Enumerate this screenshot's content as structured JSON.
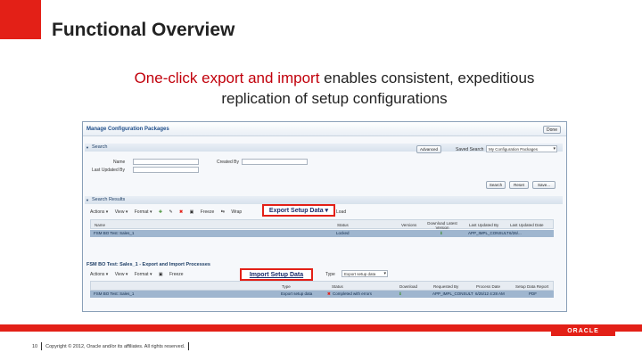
{
  "slide": {
    "title": "Functional Overview",
    "subtitle_highlight": "One-click export and import",
    "subtitle_rest_line1": " enables consistent, expeditious",
    "subtitle_line2": "replication of setup configurations"
  },
  "screenshot": {
    "window_title": "Manage Configuration Packages",
    "done_label": "Done",
    "search": {
      "section_label": "Search",
      "name_label": "Name",
      "created_by_label": "Created By",
      "last_updated_by_label": "Last Updated By",
      "advanced_label": "Advanced",
      "saved_search_label": "Saved Search",
      "saved_search_value": "My Configuration Packages",
      "search_button": "Search",
      "reset_button": "Reset",
      "save_button": "Save..."
    },
    "results": {
      "section_label": "Search Results",
      "toolbar": [
        "Actions ▾",
        "View ▾",
        "Format ▾"
      ],
      "freeze_label": "Freeze",
      "wrap_label": "Wrap",
      "callout_text": "Export Setup Data",
      "callout_suffix": "Load",
      "headers": [
        "Name",
        "Status",
        "Versions",
        "Last Updated By",
        "Last Updated Date"
      ],
      "header_extra": "Download Latest Version",
      "row": [
        "FSM BO Test: Sales_1",
        "Locked",
        "",
        "APP_IMPL_CONSULT",
        "6/26/..."
      ]
    },
    "processes": {
      "section_label": "FSM BO Test: Sales_1 - Export and Import Processes",
      "toolbar": [
        "Actions ▾",
        "View ▾",
        "Format ▾"
      ],
      "freeze_label": "Freeze",
      "callout_text": "Import Setup Data",
      "type_label": "Type",
      "type_value": "Export setup data",
      "headers": [
        "Type",
        "Status",
        "Download",
        "Requested By",
        "Process Date",
        "Setup Data Report"
      ],
      "row": [
        "FSM BO Test: Sales_1",
        "Export setup data",
        "Completed with errors",
        "",
        "APP_IMPL_CONSULT",
        "6/25/12 4:28 AM",
        "PDF"
      ]
    }
  },
  "footer": {
    "page_number": "10",
    "copyright": "Copyright © 2012, Oracle and/or its affiliates. All rights reserved.",
    "brand": "ORACLE"
  },
  "colors": {
    "accent": "#e32017",
    "highlight_text": "#c1000b",
    "table_row_selected": "#9fb6cf"
  }
}
